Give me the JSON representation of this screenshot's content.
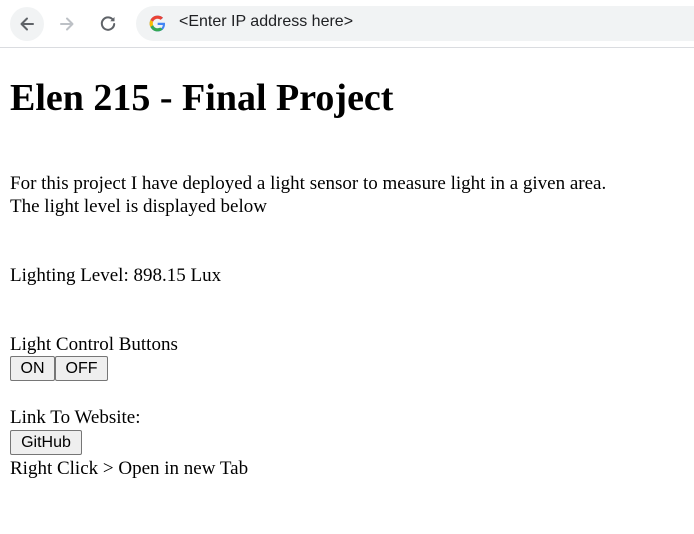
{
  "browser": {
    "url_text": "<Enter IP address here>",
    "icons": {
      "back": "arrow-left-icon",
      "forward": "arrow-right-icon",
      "reload": "reload-icon",
      "site": "google-g-icon"
    }
  },
  "page": {
    "title": "Elen 215 - Final Project",
    "description_line1": "For this project I have deployed a light sensor to measure light in a given area.",
    "description_line2": "The light level is displayed below",
    "lighting_level": "Lighting Level: 898.15 Lux",
    "controls_label": "Light Control Buttons",
    "on_button": "ON",
    "off_button": "OFF",
    "link_label": "Link To Website:",
    "github_button": "GitHub",
    "hint": "Right Click > Open in new Tab"
  }
}
